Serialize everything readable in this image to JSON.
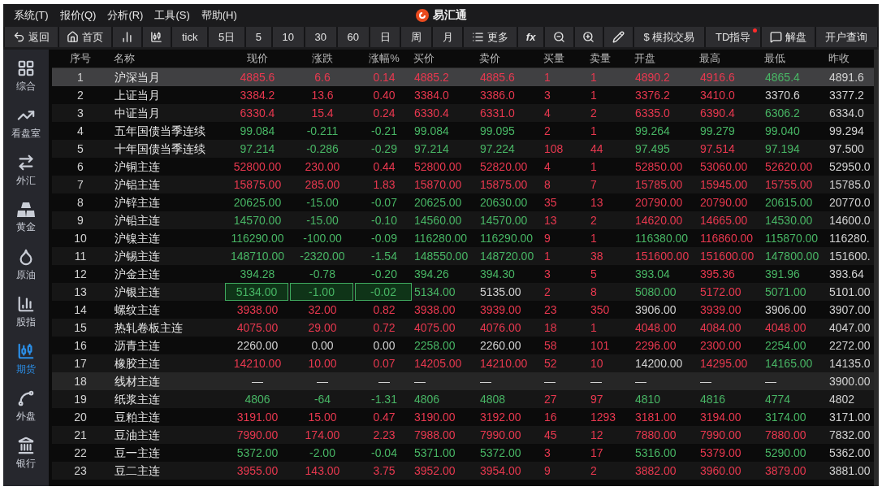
{
  "menu": [
    "系统(T)",
    "报价(Q)",
    "分析(R)",
    "工具(S)",
    "帮助(H)"
  ],
  "app_title": "易汇通",
  "toolbar": [
    {
      "kind": "back",
      "label": "返回"
    },
    {
      "kind": "home",
      "label": "首页"
    },
    {
      "kind": "bars"
    },
    {
      "kind": "candles"
    },
    {
      "kind": "text",
      "label": "tick"
    },
    {
      "kind": "text",
      "label": "5日"
    },
    {
      "kind": "text",
      "label": "5"
    },
    {
      "kind": "text",
      "label": "10"
    },
    {
      "kind": "text",
      "label": "30"
    },
    {
      "kind": "text",
      "label": "60"
    },
    {
      "kind": "text",
      "label": "日"
    },
    {
      "kind": "text",
      "label": "周"
    },
    {
      "kind": "text",
      "label": "月"
    },
    {
      "kind": "list",
      "label": "更多"
    },
    {
      "kind": "formula",
      "label": "fx"
    },
    {
      "kind": "zoom-out"
    },
    {
      "kind": "zoom-in"
    },
    {
      "kind": "pen"
    },
    {
      "kind": "text",
      "label": "$ 模拟交易"
    },
    {
      "kind": "text",
      "label": "TD指导",
      "badge": true
    },
    {
      "kind": "chat",
      "label": "解盘"
    },
    {
      "kind": "text",
      "label": "开户查询"
    }
  ],
  "sidebar": [
    {
      "kind": "grid",
      "label": "综合",
      "selected": false
    },
    {
      "kind": "trend",
      "label": "看盘室",
      "selected": false
    },
    {
      "kind": "forex",
      "label": "外汇",
      "selected": false
    },
    {
      "kind": "gold",
      "label": "黄金",
      "selected": false
    },
    {
      "kind": "drop",
      "label": "原油",
      "selected": false
    },
    {
      "kind": "index",
      "label": "股指",
      "selected": false
    },
    {
      "kind": "candles",
      "label": "期货",
      "selected": true
    },
    {
      "kind": "nodes",
      "label": "外盘",
      "selected": false
    },
    {
      "kind": "bank",
      "label": "银行",
      "selected": false
    }
  ],
  "table": {
    "columns": [
      "序号",
      "名称",
      "现价",
      "涨跌",
      "涨幅%",
      "买价",
      "卖价",
      "买量",
      "卖量",
      "开盘",
      "最高",
      "最低",
      "昨收"
    ],
    "rows": [
      {
        "selected": true,
        "suspended": false,
        "flashing": false,
        "cells": [
          {
            "text": "1",
            "color": "#d2d2d2"
          },
          {
            "text": "沪深当月",
            "color": "#e6e6e6"
          },
          {
            "text": "4885.6",
            "color": "#e8384f"
          },
          {
            "text": "6.6",
            "color": "#e8384f"
          },
          {
            "text": "0.14",
            "color": "#e8384f"
          },
          {
            "text": "4885.2",
            "color": "#e8384f"
          },
          {
            "text": "4885.6",
            "color": "#e8384f"
          },
          {
            "text": "1",
            "color": "#e8384f"
          },
          {
            "text": "1",
            "color": "#e8384f"
          },
          {
            "text": "4890.2",
            "color": "#e8384f"
          },
          {
            "text": "4916.6",
            "color": "#e8384f"
          },
          {
            "text": "4865.4",
            "color": "#48b665"
          },
          {
            "text": "4891.6",
            "color": "#d2d2d2"
          }
        ]
      },
      {
        "selected": false,
        "suspended": false,
        "flashing": false,
        "cells": [
          {
            "text": "2",
            "color": "#d2d2d2"
          },
          {
            "text": "上证当月",
            "color": "#e6e6e6"
          },
          {
            "text": "3384.2",
            "color": "#e8384f"
          },
          {
            "text": "13.6",
            "color": "#e8384f"
          },
          {
            "text": "0.40",
            "color": "#e8384f"
          },
          {
            "text": "3384.0",
            "color": "#e8384f"
          },
          {
            "text": "3386.0",
            "color": "#e8384f"
          },
          {
            "text": "3",
            "color": "#e8384f"
          },
          {
            "text": "1",
            "color": "#e8384f"
          },
          {
            "text": "3376.2",
            "color": "#e8384f"
          },
          {
            "text": "3410.0",
            "color": "#e8384f"
          },
          {
            "text": "3370.6",
            "color": "#d2d2d2"
          },
          {
            "text": "3377.2",
            "color": "#d2d2d2"
          }
        ]
      },
      {
        "selected": false,
        "suspended": false,
        "flashing": false,
        "cells": [
          {
            "text": "3",
            "color": "#d2d2d2"
          },
          {
            "text": "中证当月",
            "color": "#e6e6e6"
          },
          {
            "text": "6330.4",
            "color": "#e8384f"
          },
          {
            "text": "15.4",
            "color": "#e8384f"
          },
          {
            "text": "0.24",
            "color": "#e8384f"
          },
          {
            "text": "6330.4",
            "color": "#e8384f"
          },
          {
            "text": "6331.0",
            "color": "#e8384f"
          },
          {
            "text": "4",
            "color": "#e8384f"
          },
          {
            "text": "2",
            "color": "#e8384f"
          },
          {
            "text": "6335.0",
            "color": "#e8384f"
          },
          {
            "text": "6390.4",
            "color": "#e8384f"
          },
          {
            "text": "6306.2",
            "color": "#48b665"
          },
          {
            "text": "6334.0",
            "color": "#d2d2d2"
          }
        ]
      },
      {
        "selected": false,
        "suspended": false,
        "flashing": false,
        "cells": [
          {
            "text": "4",
            "color": "#d2d2d2"
          },
          {
            "text": "五年国债当季连续",
            "color": "#e6e6e6"
          },
          {
            "text": "99.084",
            "color": "#48b665"
          },
          {
            "text": "-0.211",
            "color": "#48b665"
          },
          {
            "text": "-0.21",
            "color": "#48b665"
          },
          {
            "text": "99.084",
            "color": "#48b665"
          },
          {
            "text": "99.095",
            "color": "#48b665"
          },
          {
            "text": "2",
            "color": "#e8384f"
          },
          {
            "text": "1",
            "color": "#e8384f"
          },
          {
            "text": "99.264",
            "color": "#48b665"
          },
          {
            "text": "99.279",
            "color": "#48b665"
          },
          {
            "text": "99.040",
            "color": "#48b665"
          },
          {
            "text": "99.294",
            "color": "#d2d2d2"
          }
        ]
      },
      {
        "selected": false,
        "suspended": false,
        "flashing": false,
        "cells": [
          {
            "text": "5",
            "color": "#d2d2d2"
          },
          {
            "text": "十年国债当季连续",
            "color": "#e6e6e6"
          },
          {
            "text": "97.214",
            "color": "#48b665"
          },
          {
            "text": "-0.286",
            "color": "#48b665"
          },
          {
            "text": "-0.29",
            "color": "#48b665"
          },
          {
            "text": "97.214",
            "color": "#48b665"
          },
          {
            "text": "97.224",
            "color": "#48b665"
          },
          {
            "text": "108",
            "color": "#e8384f"
          },
          {
            "text": "44",
            "color": "#e8384f"
          },
          {
            "text": "97.495",
            "color": "#48b665"
          },
          {
            "text": "97.514",
            "color": "#e8384f"
          },
          {
            "text": "97.194",
            "color": "#48b665"
          },
          {
            "text": "97.500",
            "color": "#d2d2d2"
          }
        ]
      },
      {
        "selected": false,
        "suspended": false,
        "flashing": false,
        "cells": [
          {
            "text": "6",
            "color": "#d2d2d2"
          },
          {
            "text": "沪铜主连",
            "color": "#e6e6e6"
          },
          {
            "text": "52800.00",
            "color": "#e8384f"
          },
          {
            "text": "230.00",
            "color": "#e8384f"
          },
          {
            "text": "0.44",
            "color": "#e8384f"
          },
          {
            "text": "52800.00",
            "color": "#e8384f"
          },
          {
            "text": "52820.00",
            "color": "#e8384f"
          },
          {
            "text": "4",
            "color": "#e8384f"
          },
          {
            "text": "1",
            "color": "#e8384f"
          },
          {
            "text": "52850.00",
            "color": "#e8384f"
          },
          {
            "text": "53060.00",
            "color": "#e8384f"
          },
          {
            "text": "52620.00",
            "color": "#e8384f"
          },
          {
            "text": "52950.0",
            "color": "#d2d2d2"
          }
        ]
      },
      {
        "selected": false,
        "suspended": false,
        "flashing": false,
        "cells": [
          {
            "text": "7",
            "color": "#d2d2d2"
          },
          {
            "text": "沪铝主连",
            "color": "#e6e6e6"
          },
          {
            "text": "15875.00",
            "color": "#e8384f"
          },
          {
            "text": "285.00",
            "color": "#e8384f"
          },
          {
            "text": "1.83",
            "color": "#e8384f"
          },
          {
            "text": "15870.00",
            "color": "#e8384f"
          },
          {
            "text": "15875.00",
            "color": "#e8384f"
          },
          {
            "text": "8",
            "color": "#e8384f"
          },
          {
            "text": "7",
            "color": "#e8384f"
          },
          {
            "text": "15785.00",
            "color": "#e8384f"
          },
          {
            "text": "15945.00",
            "color": "#e8384f"
          },
          {
            "text": "15755.00",
            "color": "#e8384f"
          },
          {
            "text": "15785.0",
            "color": "#d2d2d2"
          }
        ]
      },
      {
        "selected": false,
        "suspended": false,
        "flashing": false,
        "cells": [
          {
            "text": "8",
            "color": "#d2d2d2"
          },
          {
            "text": "沪锌主连",
            "color": "#e6e6e6"
          },
          {
            "text": "20625.00",
            "color": "#48b665"
          },
          {
            "text": "-15.00",
            "color": "#48b665"
          },
          {
            "text": "-0.07",
            "color": "#48b665"
          },
          {
            "text": "20625.00",
            "color": "#48b665"
          },
          {
            "text": "20630.00",
            "color": "#48b665"
          },
          {
            "text": "35",
            "color": "#e8384f"
          },
          {
            "text": "13",
            "color": "#e8384f"
          },
          {
            "text": "20790.00",
            "color": "#e8384f"
          },
          {
            "text": "20790.00",
            "color": "#e8384f"
          },
          {
            "text": "20615.00",
            "color": "#48b665"
          },
          {
            "text": "20770.0",
            "color": "#d2d2d2"
          }
        ]
      },
      {
        "selected": false,
        "suspended": false,
        "flashing": false,
        "cells": [
          {
            "text": "9",
            "color": "#d2d2d2"
          },
          {
            "text": "沪铅主连",
            "color": "#e6e6e6"
          },
          {
            "text": "14570.00",
            "color": "#48b665"
          },
          {
            "text": "-15.00",
            "color": "#48b665"
          },
          {
            "text": "-0.10",
            "color": "#48b665"
          },
          {
            "text": "14560.00",
            "color": "#48b665"
          },
          {
            "text": "14570.00",
            "color": "#48b665"
          },
          {
            "text": "13",
            "color": "#e8384f"
          },
          {
            "text": "2",
            "color": "#e8384f"
          },
          {
            "text": "14620.00",
            "color": "#e8384f"
          },
          {
            "text": "14665.00",
            "color": "#e8384f"
          },
          {
            "text": "14530.00",
            "color": "#48b665"
          },
          {
            "text": "14600.0",
            "color": "#d2d2d2"
          }
        ]
      },
      {
        "selected": false,
        "suspended": false,
        "flashing": false,
        "cells": [
          {
            "text": "10",
            "color": "#d2d2d2"
          },
          {
            "text": "沪镍主连",
            "color": "#e6e6e6"
          },
          {
            "text": "116290.00",
            "color": "#48b665"
          },
          {
            "text": "-100.00",
            "color": "#48b665"
          },
          {
            "text": "-0.09",
            "color": "#48b665"
          },
          {
            "text": "116280.00",
            "color": "#48b665"
          },
          {
            "text": "116290.00",
            "color": "#48b665"
          },
          {
            "text": "9",
            "color": "#e8384f"
          },
          {
            "text": "1",
            "color": "#e8384f"
          },
          {
            "text": "116380.00",
            "color": "#48b665"
          },
          {
            "text": "116860.00",
            "color": "#e8384f"
          },
          {
            "text": "115870.00",
            "color": "#48b665"
          },
          {
            "text": "116280.",
            "color": "#d2d2d2"
          }
        ]
      },
      {
        "selected": false,
        "suspended": false,
        "flashing": false,
        "cells": [
          {
            "text": "11",
            "color": "#d2d2d2"
          },
          {
            "text": "沪锡主连",
            "color": "#e6e6e6"
          },
          {
            "text": "148710.00",
            "color": "#48b665"
          },
          {
            "text": "-2320.00",
            "color": "#48b665"
          },
          {
            "text": "-1.54",
            "color": "#48b665"
          },
          {
            "text": "148550.00",
            "color": "#48b665"
          },
          {
            "text": "148720.00",
            "color": "#48b665"
          },
          {
            "text": "1",
            "color": "#e8384f"
          },
          {
            "text": "38",
            "color": "#e8384f"
          },
          {
            "text": "151600.00",
            "color": "#e8384f"
          },
          {
            "text": "151600.00",
            "color": "#e8384f"
          },
          {
            "text": "147800.00",
            "color": "#48b665"
          },
          {
            "text": "151600.",
            "color": "#d2d2d2"
          }
        ]
      },
      {
        "selected": false,
        "suspended": false,
        "flashing": false,
        "cells": [
          {
            "text": "12",
            "color": "#d2d2d2"
          },
          {
            "text": "沪金主连",
            "color": "#e6e6e6"
          },
          {
            "text": "394.28",
            "color": "#48b665"
          },
          {
            "text": "-0.78",
            "color": "#48b665"
          },
          {
            "text": "-0.20",
            "color": "#48b665"
          },
          {
            "text": "394.26",
            "color": "#48b665"
          },
          {
            "text": "394.30",
            "color": "#48b665"
          },
          {
            "text": "3",
            "color": "#e8384f"
          },
          {
            "text": "5",
            "color": "#e8384f"
          },
          {
            "text": "393.04",
            "color": "#48b665"
          },
          {
            "text": "395.36",
            "color": "#e8384f"
          },
          {
            "text": "391.96",
            "color": "#48b665"
          },
          {
            "text": "393.64",
            "color": "#d2d2d2"
          }
        ]
      },
      {
        "selected": false,
        "suspended": false,
        "flashing": true,
        "cells": [
          {
            "text": "13",
            "color": "#d2d2d2"
          },
          {
            "text": "沪银主连",
            "color": "#e6e6e6"
          },
          {
            "text": "5134.00",
            "color": "#48b665"
          },
          {
            "text": "-1.00",
            "color": "#48b665"
          },
          {
            "text": "-0.02",
            "color": "#48b665"
          },
          {
            "text": "5134.00",
            "color": "#48b665"
          },
          {
            "text": "5135.00",
            "color": "#d2d2d2"
          },
          {
            "text": "2",
            "color": "#e8384f"
          },
          {
            "text": "8",
            "color": "#e8384f"
          },
          {
            "text": "5080.00",
            "color": "#48b665"
          },
          {
            "text": "5172.00",
            "color": "#e8384f"
          },
          {
            "text": "5071.00",
            "color": "#48b665"
          },
          {
            "text": "5101.00",
            "color": "#d2d2d2"
          }
        ]
      },
      {
        "selected": false,
        "suspended": false,
        "flashing": false,
        "cells": [
          {
            "text": "14",
            "color": "#d2d2d2"
          },
          {
            "text": "螺纹主连",
            "color": "#e6e6e6"
          },
          {
            "text": "3938.00",
            "color": "#e8384f"
          },
          {
            "text": "32.00",
            "color": "#e8384f"
          },
          {
            "text": "0.82",
            "color": "#e8384f"
          },
          {
            "text": "3938.00",
            "color": "#e8384f"
          },
          {
            "text": "3939.00",
            "color": "#e8384f"
          },
          {
            "text": "23",
            "color": "#e8384f"
          },
          {
            "text": "350",
            "color": "#e8384f"
          },
          {
            "text": "3906.00",
            "color": "#d2d2d2"
          },
          {
            "text": "3939.00",
            "color": "#e8384f"
          },
          {
            "text": "3906.00",
            "color": "#d2d2d2"
          },
          {
            "text": "3907.00",
            "color": "#d2d2d2"
          }
        ]
      },
      {
        "selected": false,
        "suspended": false,
        "flashing": false,
        "cells": [
          {
            "text": "15",
            "color": "#d2d2d2"
          },
          {
            "text": "热轧卷板主连",
            "color": "#e6e6e6"
          },
          {
            "text": "4075.00",
            "color": "#e8384f"
          },
          {
            "text": "29.00",
            "color": "#e8384f"
          },
          {
            "text": "0.72",
            "color": "#e8384f"
          },
          {
            "text": "4075.00",
            "color": "#e8384f"
          },
          {
            "text": "4076.00",
            "color": "#e8384f"
          },
          {
            "text": "18",
            "color": "#e8384f"
          },
          {
            "text": "1",
            "color": "#e8384f"
          },
          {
            "text": "4048.00",
            "color": "#e8384f"
          },
          {
            "text": "4084.00",
            "color": "#e8384f"
          },
          {
            "text": "4048.00",
            "color": "#e8384f"
          },
          {
            "text": "4047.00",
            "color": "#d2d2d2"
          }
        ]
      },
      {
        "selected": false,
        "suspended": false,
        "flashing": false,
        "cells": [
          {
            "text": "16",
            "color": "#d2d2d2"
          },
          {
            "text": "沥青主连",
            "color": "#e6e6e6"
          },
          {
            "text": "2260.00",
            "color": "#d2d2d2"
          },
          {
            "text": "0.00",
            "color": "#d2d2d2"
          },
          {
            "text": "0.00",
            "color": "#d2d2d2"
          },
          {
            "text": "2258.00",
            "color": "#48b665"
          },
          {
            "text": "2260.00",
            "color": "#d2d2d2"
          },
          {
            "text": "58",
            "color": "#e8384f"
          },
          {
            "text": "101",
            "color": "#e8384f"
          },
          {
            "text": "2296.00",
            "color": "#e8384f"
          },
          {
            "text": "2300.00",
            "color": "#e8384f"
          },
          {
            "text": "2254.00",
            "color": "#48b665"
          },
          {
            "text": "2272.00",
            "color": "#d2d2d2"
          }
        ]
      },
      {
        "selected": false,
        "suspended": false,
        "flashing": false,
        "cells": [
          {
            "text": "17",
            "color": "#d2d2d2"
          },
          {
            "text": "橡胶主连",
            "color": "#e6e6e6"
          },
          {
            "text": "14210.00",
            "color": "#e8384f"
          },
          {
            "text": "10.00",
            "color": "#e8384f"
          },
          {
            "text": "0.07",
            "color": "#e8384f"
          },
          {
            "text": "14205.00",
            "color": "#e8384f"
          },
          {
            "text": "14210.00",
            "color": "#e8384f"
          },
          {
            "text": "52",
            "color": "#e8384f"
          },
          {
            "text": "10",
            "color": "#e8384f"
          },
          {
            "text": "14200.00",
            "color": "#d2d2d2"
          },
          {
            "text": "14295.00",
            "color": "#e8384f"
          },
          {
            "text": "14165.00",
            "color": "#48b665"
          },
          {
            "text": "14135.0",
            "color": "#d2d2d2"
          }
        ]
      },
      {
        "selected": false,
        "suspended": true,
        "flashing": false,
        "cells": [
          {
            "text": "18",
            "color": "#d2d2d2"
          },
          {
            "text": "线材主连",
            "color": "#e6e6e6"
          },
          {
            "text": "—",
            "color": "#d2d2d2"
          },
          {
            "text": "—",
            "color": "#d2d2d2"
          },
          {
            "text": "—",
            "color": "#d2d2d2"
          },
          {
            "text": "—",
            "color": "#d2d2d2"
          },
          {
            "text": "—",
            "color": "#d2d2d2"
          },
          {
            "text": "—",
            "color": "#d2d2d2"
          },
          {
            "text": "—",
            "color": "#d2d2d2"
          },
          {
            "text": "—",
            "color": "#d2d2d2"
          },
          {
            "text": "—",
            "color": "#d2d2d2"
          },
          {
            "text": "—",
            "color": "#d2d2d2"
          },
          {
            "text": "3900.00",
            "color": "#d2d2d2"
          }
        ]
      },
      {
        "selected": false,
        "suspended": false,
        "flashing": false,
        "cells": [
          {
            "text": "19",
            "color": "#d2d2d2"
          },
          {
            "text": "纸浆主连",
            "color": "#e6e6e6"
          },
          {
            "text": "4806",
            "color": "#48b665"
          },
          {
            "text": "-64",
            "color": "#48b665"
          },
          {
            "text": "-1.31",
            "color": "#48b665"
          },
          {
            "text": "4806",
            "color": "#48b665"
          },
          {
            "text": "4808",
            "color": "#48b665"
          },
          {
            "text": "27",
            "color": "#e8384f"
          },
          {
            "text": "97",
            "color": "#e8384f"
          },
          {
            "text": "4810",
            "color": "#48b665"
          },
          {
            "text": "4816",
            "color": "#48b665"
          },
          {
            "text": "4774",
            "color": "#48b665"
          },
          {
            "text": "4802",
            "color": "#d2d2d2"
          }
        ]
      },
      {
        "selected": false,
        "suspended": false,
        "flashing": false,
        "cells": [
          {
            "text": "20",
            "color": "#d2d2d2"
          },
          {
            "text": "豆粕主连",
            "color": "#e6e6e6"
          },
          {
            "text": "3191.00",
            "color": "#e8384f"
          },
          {
            "text": "15.00",
            "color": "#e8384f"
          },
          {
            "text": "0.47",
            "color": "#e8384f"
          },
          {
            "text": "3190.00",
            "color": "#e8384f"
          },
          {
            "text": "3192.00",
            "color": "#e8384f"
          },
          {
            "text": "16",
            "color": "#e8384f"
          },
          {
            "text": "1293",
            "color": "#e8384f"
          },
          {
            "text": "3181.00",
            "color": "#e8384f"
          },
          {
            "text": "3194.00",
            "color": "#e8384f"
          },
          {
            "text": "3174.00",
            "color": "#48b665"
          },
          {
            "text": "3171.00",
            "color": "#d2d2d2"
          }
        ]
      },
      {
        "selected": false,
        "suspended": false,
        "flashing": false,
        "cells": [
          {
            "text": "21",
            "color": "#d2d2d2"
          },
          {
            "text": "豆油主连",
            "color": "#e6e6e6"
          },
          {
            "text": "7990.00",
            "color": "#e8384f"
          },
          {
            "text": "174.00",
            "color": "#e8384f"
          },
          {
            "text": "2.23",
            "color": "#e8384f"
          },
          {
            "text": "7988.00",
            "color": "#e8384f"
          },
          {
            "text": "7990.00",
            "color": "#e8384f"
          },
          {
            "text": "45",
            "color": "#e8384f"
          },
          {
            "text": "12",
            "color": "#e8384f"
          },
          {
            "text": "7880.00",
            "color": "#e8384f"
          },
          {
            "text": "7990.00",
            "color": "#e8384f"
          },
          {
            "text": "7880.00",
            "color": "#e8384f"
          },
          {
            "text": "7832.00",
            "color": "#d2d2d2"
          }
        ]
      },
      {
        "selected": false,
        "suspended": false,
        "flashing": false,
        "cells": [
          {
            "text": "22",
            "color": "#d2d2d2"
          },
          {
            "text": "豆一主连",
            "color": "#e6e6e6"
          },
          {
            "text": "5372.00",
            "color": "#48b665"
          },
          {
            "text": "-2.00",
            "color": "#48b665"
          },
          {
            "text": "-0.04",
            "color": "#48b665"
          },
          {
            "text": "5371.00",
            "color": "#48b665"
          },
          {
            "text": "5372.00",
            "color": "#48b665"
          },
          {
            "text": "3",
            "color": "#e8384f"
          },
          {
            "text": "17",
            "color": "#e8384f"
          },
          {
            "text": "5316.00",
            "color": "#48b665"
          },
          {
            "text": "5379.00",
            "color": "#e8384f"
          },
          {
            "text": "5290.00",
            "color": "#48b665"
          },
          {
            "text": "5362.00",
            "color": "#d2d2d2"
          }
        ]
      },
      {
        "selected": false,
        "suspended": false,
        "flashing": false,
        "cells": [
          {
            "text": "23",
            "color": "#d2d2d2"
          },
          {
            "text": "豆二主连",
            "color": "#e6e6e6"
          },
          {
            "text": "3955.00",
            "color": "#e8384f"
          },
          {
            "text": "143.00",
            "color": "#e8384f"
          },
          {
            "text": "3.75",
            "color": "#e8384f"
          },
          {
            "text": "3952.00",
            "color": "#e8384f"
          },
          {
            "text": "3954.00",
            "color": "#e8384f"
          },
          {
            "text": "9",
            "color": "#e8384f"
          },
          {
            "text": "2",
            "color": "#e8384f"
          },
          {
            "text": "3882.00",
            "color": "#e8384f"
          },
          {
            "text": "3960.00",
            "color": "#e8384f"
          },
          {
            "text": "3879.00",
            "color": "#e8384f"
          },
          {
            "text": "3881.00",
            "color": "#d2d2d2"
          }
        ]
      }
    ]
  }
}
